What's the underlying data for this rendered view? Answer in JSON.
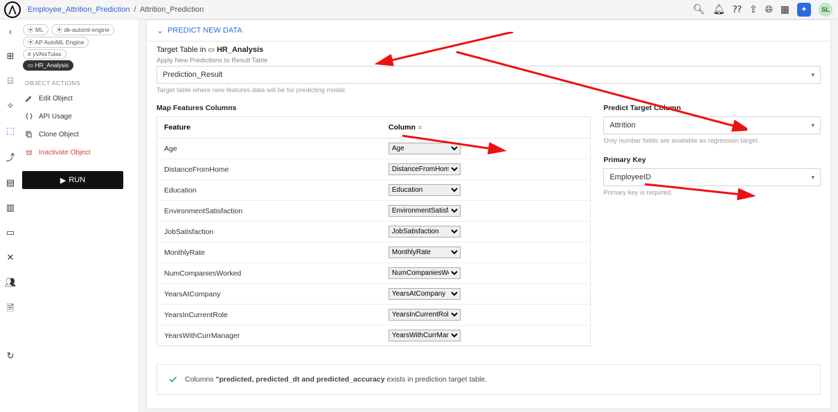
{
  "breadcrumb": {
    "parent": "Employee_Attrition_Prediction",
    "current": "Attrition_Prediction"
  },
  "top_icons": {
    "user_initials": "SL"
  },
  "left": {
    "tags": [
      "ML",
      "dk-automl-engine",
      "AP AutoML Engine",
      "yVAisTulas"
    ],
    "active_tag": "HR_Analysis",
    "section_label": "OBJECT ACTIONS",
    "actions": {
      "edit": "Edit Object",
      "api": "API Usage",
      "clone": "Clone Object",
      "inactivate": "Inactivate Object"
    },
    "run": "RUN"
  },
  "main": {
    "section_title": "PREDICT NEW DATA",
    "target_table_prefix": "Target Table in",
    "target_table_name": "HR_Analysis",
    "apply_label": "Apply New Predictions to Result Table",
    "result_table": "Prediction_Result",
    "result_help": "Target table where new features data will be for predicting model.",
    "map_label": "Map Features Columns",
    "table": {
      "head_feature": "Feature",
      "head_column": "Column",
      "rows": [
        {
          "feature": "Age",
          "column": "Age"
        },
        {
          "feature": "DistanceFromHome",
          "column": "DistanceFromHome"
        },
        {
          "feature": "Education",
          "column": "Education"
        },
        {
          "feature": "EnvironmentSatisfaction",
          "column": "EnvironmentSatisfaction"
        },
        {
          "feature": "JobSatisfaction",
          "column": "JobSatisfaction"
        },
        {
          "feature": "MonthlyRate",
          "column": "MonthlyRate"
        },
        {
          "feature": "NumCompaniesWorked",
          "column": "NumCompaniesWorked"
        },
        {
          "feature": "YearsAtCompany",
          "column": "YearsAtCompany"
        },
        {
          "feature": "YearsInCurrentRole",
          "column": "YearsInCurrentRole"
        },
        {
          "feature": "YearsWithCurrManager",
          "column": "YearsWithCurrManager"
        }
      ]
    },
    "right": {
      "predict_label": "Predict Target Column",
      "predict_value": "Attrition",
      "predict_help": "Only number fields are available as regression target.",
      "pk_label": "Primary Key",
      "pk_value": "EmployeeID",
      "pk_help": "Primary key is required."
    },
    "status_prefix": "Columns ",
    "status_cols": "\"predicted, predicted_dt and predicted_accuracy",
    "status_suffix": " exists in prediction target table."
  }
}
